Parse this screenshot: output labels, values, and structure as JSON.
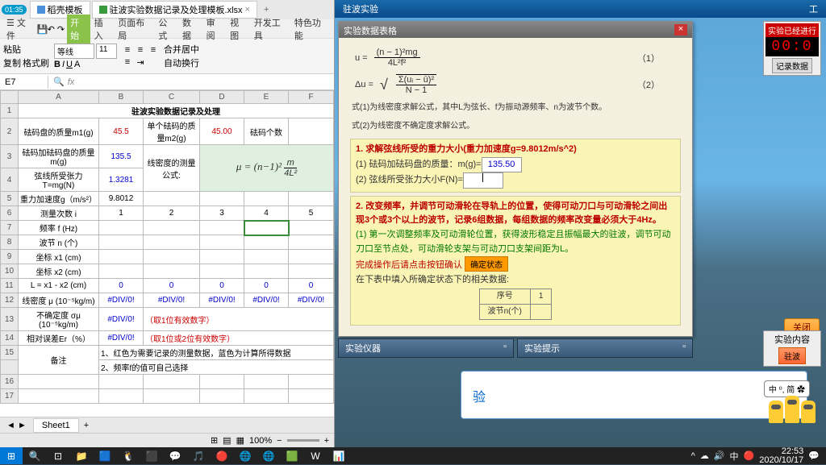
{
  "wps": {
    "timer_badge": "01:35",
    "tab1": "稻壳模板",
    "tab2": "驻波实验数据记录及处理模板.xlsx",
    "menu": {
      "file": "文件",
      "start": "开始",
      "insert": "插入",
      "layout": "页面布局",
      "formula": "公式",
      "data": "数据",
      "review": "审阅",
      "view": "视图",
      "dev": "开发工具",
      "special": "特色功能"
    },
    "ribbon": {
      "paste": "粘贴",
      "copy": "复制",
      "format": "格式刷",
      "font": "等线",
      "size": "11",
      "merge": "合并居中",
      "wrap": "自动换行"
    },
    "cellref": "E7",
    "title": "驻波实验数据记录及处理",
    "rows": {
      "r2a": "砝码盘的质量m1(g)",
      "r2b": "45.5",
      "r2c": "单个砝码的质量m2(g)",
      "r2d": "45.00",
      "r2e": "砝码个数",
      "r3a": "砝码加砝码盘的质量m(g)",
      "r3b": "135.5",
      "r4a": "弦线所受张力T=mg(N)",
      "r4b": "1.3281",
      "r4c": "线密度的测量公式:",
      "r5a": "重力加速度g（m/s²）",
      "r5b": "9.8012",
      "r6a": "测量次数 i",
      "r6b": "1",
      "r6c": "2",
      "r6d": "3",
      "r6e": "4",
      "r6f": "5",
      "r7a": "频率 f (Hz)",
      "r8a": "波节 n (个)",
      "r9a": "坐标 x1 (cm)",
      "r10a": "坐标 x2 (cm)",
      "r11a": "L = x1 - x2 (cm)",
      "r11v": "0",
      "r12a": "线密度 μ (10⁻⁵kg/m)",
      "div": "#DIV/0!",
      "r13a": "不确定度 σμ (10⁻⁵kg/m)",
      "r13n": "（取1位有效数字）",
      "r14a": "相对误差Er（%）",
      "r14n": "（取1位或2位有效数字）",
      "r15a": "备注",
      "r15b": "1、红色为需要记录的测量数据，蓝色为计算所得数据",
      "r15c": "2、频率f的值可自己选择"
    },
    "sheet_tab": "Sheet1",
    "zoom": "100%"
  },
  "sim": {
    "title": "驻波实验",
    "corner": "工",
    "timer_label": "实验已经进行",
    "timer_val": "00:0",
    "timer_btn": "记录数据",
    "panel_title": "实验数据表格",
    "eq_u": "u =",
    "eq_num1": "（1）",
    "eq_du": "Δu =",
    "eq_num2": "（2）",
    "desc1": "式(1)为线密度求解公式，其中L为弦长、f为振动源频率、n为波节个数。",
    "desc2": "式(2)为线密度不确定度求解公式。",
    "sec1_hd": "1. 求解弦线所受的重力大小(重力加速度g=9.8012m/s^2)",
    "sec1_l1": "(1) 砝码加砝码盘的质量：m(g)=",
    "sec1_v1": "135.50",
    "sec1_l2": "(2) 弦线所受张力大小F(N)=",
    "sec2_hd": "2. 改变频率，并调节可动滑轮在导轨上的位置，使得可动刀口与可动滑轮之间出现3个或3个以上的波节，记录6组数据，每组数据的频率改变量必须大于4Hz。",
    "sec2_l1": "(1) 第一次调整频率及可动滑轮位置，获得波形稳定且振幅最大的驻波，调节可动刀口至节点处，可动滑轮支架与可动刀口支架间距为L。",
    "sec2_l2": "完成操作后请点击按钮确认",
    "sec2_btn": "确定状态",
    "sec2_l3": "在下表中填入所确定状态下的相关数据:",
    "tbl_h1": "序号",
    "tbl_v1": "1",
    "tbl_h2": "波节n(个)",
    "close": "关闭",
    "bp1": "实验仪器",
    "bp2": "实验提示",
    "exp_title": "实验内容",
    "exp_btn": "驻波",
    "speech": "中 ⁰, 简 ✿",
    "sub": "验"
  },
  "taskbar": {
    "time": "22:53",
    "date": "2020/10/17"
  }
}
